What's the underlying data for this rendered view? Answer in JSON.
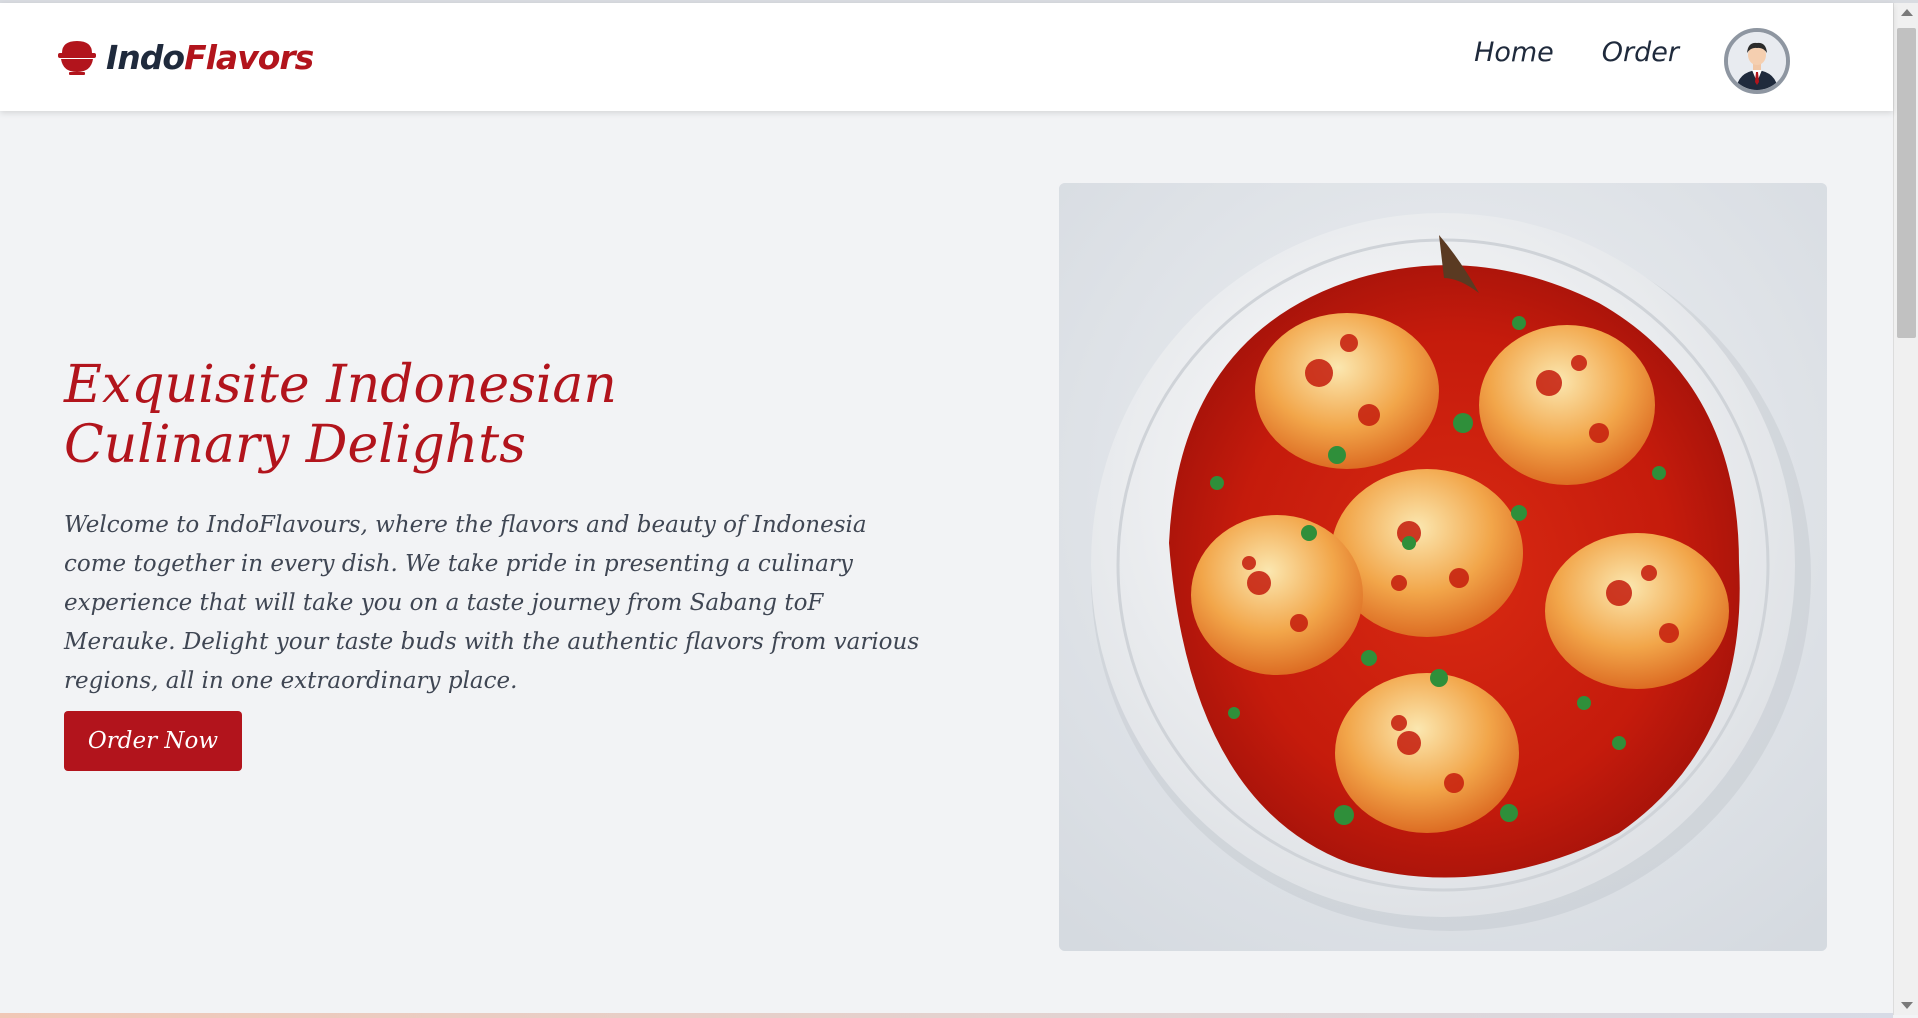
{
  "brand": {
    "part1": "Indo",
    "part2": "Flavors",
    "icon": "rice-bowl-icon"
  },
  "nav": {
    "items": [
      {
        "label": "Home"
      },
      {
        "label": "Order"
      }
    ],
    "avatar_icon": "user-avatar-icon"
  },
  "hero": {
    "title": "Exquisite Indonesian Culinary Delights",
    "description": "Welcome to IndoFlavours, where the flavors and beauty of Indonesia come together in every dish. We take pride in presenting a culinary experience that will take you on a taste journey from Sabang toF Merauke. Delight your taste buds with the authentic flavors from various regions, all in one extraordinary place.",
    "button_label": "Order Now",
    "image": "balado-eggs-dish-image"
  },
  "colors": {
    "brand_red": "#b2141c",
    "text_dark": "#1f2a3c",
    "page_bg": "#f2f3f5"
  }
}
